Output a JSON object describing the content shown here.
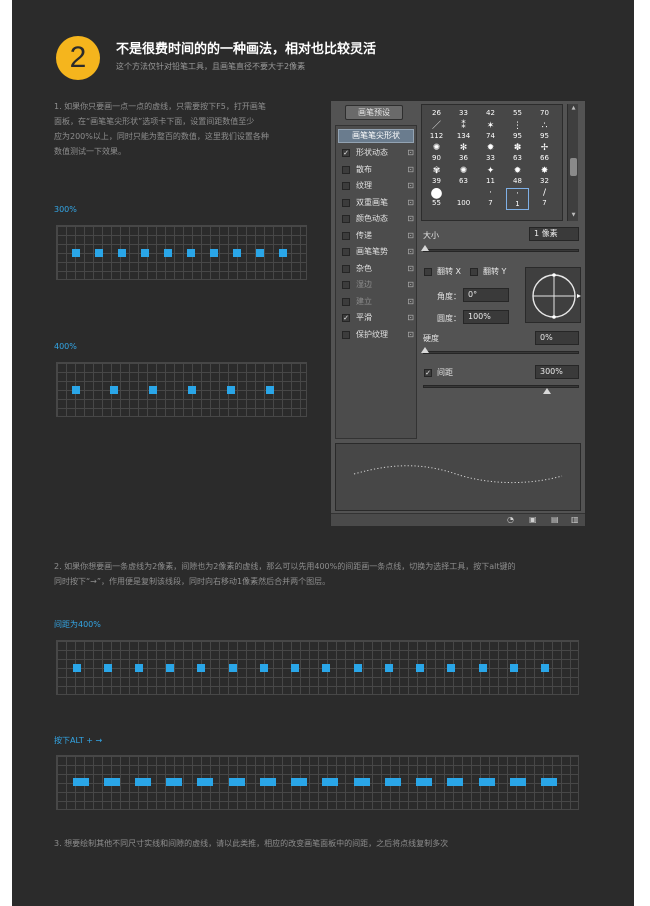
{
  "header": {
    "number": "2",
    "title": "不是很费时间的的一种画法，相对也比较灵活",
    "subtitle": "这个方法仅针对铅笔工具，且画笔直径不要大于2像素"
  },
  "step1": {
    "lines": [
      "1. 如果你只要画一点一点的虚线，只需要按下F5，打开画笔",
      "面板，在“画笔笔尖形状”选项卡下面，设置间距数值至少",
      "应为200%以上，同时只能为整百的数值，这里我们设置各种",
      "数值测试一下效果。"
    ]
  },
  "example1": {
    "label": "300%",
    "dot_count": 10
  },
  "example2": {
    "label": "400%",
    "dot_count": 6
  },
  "panel": {
    "preset_button": "画笔预设",
    "tip_shape": "画笔笔尖形状",
    "options": [
      {
        "label": "形状动态",
        "checked": true,
        "dim": false
      },
      {
        "label": "散布",
        "checked": false,
        "dim": false
      },
      {
        "label": "纹理",
        "checked": false,
        "dim": false
      },
      {
        "label": "双重画笔",
        "checked": false,
        "dim": false
      },
      {
        "label": "颜色动态",
        "checked": false,
        "dim": false
      },
      {
        "label": "传递",
        "checked": false,
        "dim": false
      },
      {
        "label": "画笔笔势",
        "checked": false,
        "dim": false
      },
      {
        "label": "杂色",
        "checked": false,
        "dim": false
      },
      {
        "label": "湿边",
        "checked": false,
        "dim": true
      },
      {
        "label": "建立",
        "checked": false,
        "dim": true
      },
      {
        "label": "平滑",
        "checked": true,
        "dim": false
      },
      {
        "label": "保护纹理",
        "checked": false,
        "dim": false
      }
    ],
    "brush_sizes": [
      "26",
      "33",
      "42",
      "55",
      "70",
      "112",
      "134",
      "74",
      "95",
      "95",
      "90",
      "36",
      "33",
      "63",
      "66",
      "39",
      "63",
      "11",
      "48",
      "32",
      "55",
      "100",
      "7",
      "1",
      "7"
    ],
    "selected_brush_index": 23,
    "size_label": "大小",
    "size_value": "1 像素",
    "flip_x": "翻转 X",
    "flip_y": "翻转 Y",
    "angle_label": "角度：",
    "angle_value": "0°",
    "roundness_label": "圆度：",
    "roundness_value": "100%",
    "hardness_label": "硬度",
    "hardness_value": "0%",
    "spacing_label": "间距",
    "spacing_value": "300%",
    "spacing_checked": true
  },
  "step2": {
    "lines": [
      "2. 如果你想要画一条虚线为2像素，间隙也为2像素的虚线，那么可以先用400%的间距画一条点线，切换为选择工具，按下alt键的",
      "同时按下“→”，作用便是复制该线段，同时向右移动1像素然后合并两个图层。"
    ]
  },
  "example3": {
    "label": "间距为400%",
    "dot_count": 16
  },
  "example4": {
    "label": "按下ALT + →",
    "dash_count": 16
  },
  "step3": {
    "text": "3. 想要绘制其他不同尺寸实线和间隙的虚线，请以此类推，相应的改变画笔面板中的间距，之后将点线复制多次"
  }
}
